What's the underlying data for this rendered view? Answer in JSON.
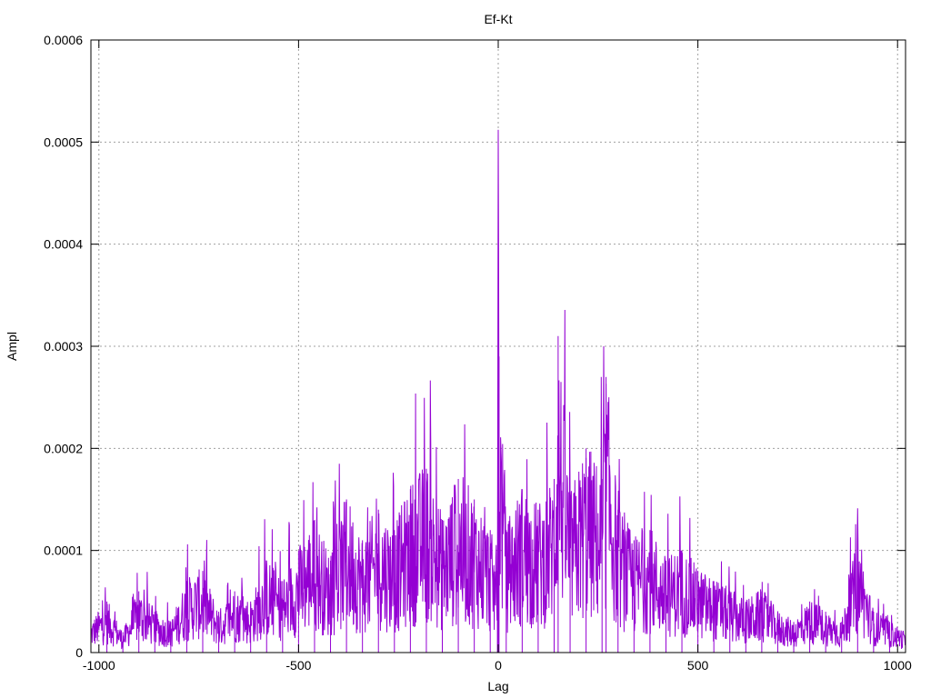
{
  "chart_data": {
    "type": "line",
    "title": "Ef-Kt",
    "xlabel": "Lag",
    "ylabel": "Ampl",
    "xlim": [
      -1020,
      1020
    ],
    "ylim": [
      0,
      0.0006
    ],
    "x_ticks": [
      -1000,
      -500,
      0,
      500,
      1000
    ],
    "x_tick_labels": [
      "-1000",
      "-500",
      "0",
      "500",
      "1000"
    ],
    "y_ticks": [
      0,
      0.0001,
      0.0002,
      0.0003,
      0.0004,
      0.0005,
      0.0006
    ],
    "y_tick_labels": [
      "0",
      "0.0001",
      "0.0002",
      "0.0003",
      "0.0004",
      "0.0005",
      "0.0006"
    ],
    "grid": true,
    "series": [
      {
        "color": "#9400d3",
        "x": [
          -1020,
          -980,
          -940,
          -900,
          -860,
          -820,
          -780,
          -740,
          -700,
          -660,
          -620,
          -580,
          -540,
          -500,
          -460,
          -420,
          -380,
          -340,
          -300,
          -260,
          -220,
          -180,
          -140,
          -100,
          -60,
          -20,
          -2,
          0,
          2,
          20,
          60,
          100,
          140,
          150,
          180,
          220,
          260,
          270,
          300,
          340,
          380,
          420,
          460,
          500,
          540,
          580,
          620,
          660,
          700,
          740,
          780,
          820,
          860,
          900,
          940,
          980,
          1020
        ],
        "y": [
          3e-05,
          5e-05,
          2e-05,
          6e-05,
          4e-05,
          3e-05,
          7e-05,
          8e-05,
          4e-05,
          6e-05,
          5e-05,
          9e-05,
          7e-05,
          0.0001,
          0.00013,
          9e-05,
          0.00015,
          0.00011,
          0.00014,
          0.00012,
          0.00016,
          0.00018,
          0.00013,
          0.00017,
          0.00015,
          0.00012,
          8e-05,
          0.000512,
          0.00029,
          0.00012,
          0.00016,
          0.00014,
          0.00017,
          0.00031,
          0.00015,
          0.0002,
          0.00017,
          0.00027,
          0.00014,
          0.00011,
          0.00012,
          9e-05,
          0.0001,
          8e-05,
          7e-05,
          6e-05,
          5e-05,
          6e-05,
          4e-05,
          3e-05,
          5e-05,
          4e-05,
          3e-05,
          0.00011,
          4e-05,
          3e-05,
          2e-05
        ]
      }
    ]
  }
}
